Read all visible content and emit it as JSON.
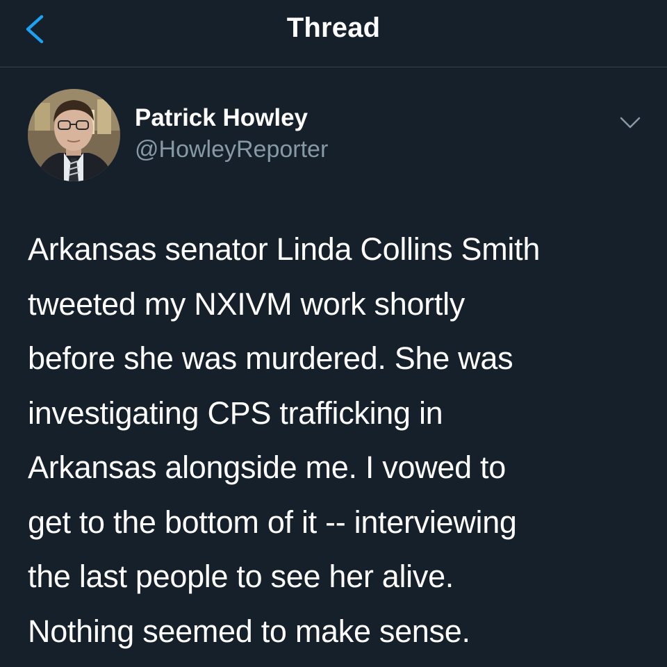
{
  "header": {
    "title": "Thread",
    "back_icon": "chevron-left-icon"
  },
  "tweet": {
    "author_name": "Patrick Howley",
    "author_handle": "@HowleyReporter",
    "menu_icon": "chevron-down-icon",
    "text": "Arkansas senator Linda Collins Smith\ntweeted my NXIVM work shortly\nbefore she was murdered. She was\ninvestigating CPS trafficking in\nArkansas alongside me. I vowed to\nget to the bottom of it -- interviewing\nthe last people to see her alive.\nNothing seemed to make sense."
  },
  "colors": {
    "background": "#15202b",
    "accent": "#1da1f2",
    "secondary_text": "#8899a6",
    "divider": "#38444d"
  }
}
